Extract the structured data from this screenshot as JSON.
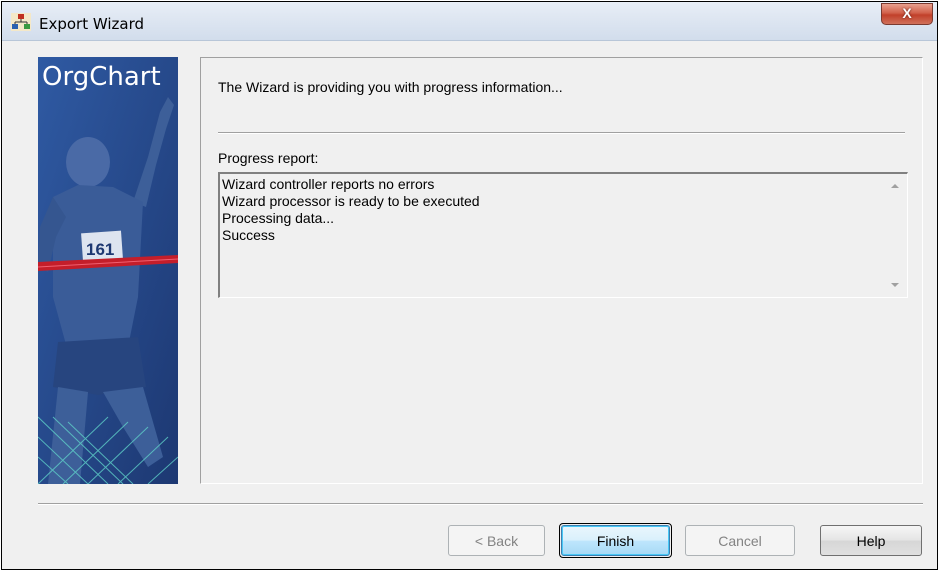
{
  "window": {
    "title": "Export Wizard",
    "close_label": "X",
    "icon": "orgchart-app-icon"
  },
  "banner": {
    "title": "OrgChart",
    "bib_number": "161",
    "image": "runner-finish-line-illustration"
  },
  "header": {
    "text": "The Wizard is providing you with progress information..."
  },
  "progress": {
    "label": "Progress report:",
    "lines": [
      "Wizard controller reports no errors",
      "Wizard processor is ready to be executed",
      "Processing data...",
      "Success"
    ]
  },
  "buttons": {
    "back": "< Back",
    "finish": "Finish",
    "cancel": "Cancel",
    "help": "Help"
  },
  "colors": {
    "banner_bg": "#27498a",
    "finish_tape": "#c41e2a",
    "dialog_bg": "#f0f0f0"
  }
}
